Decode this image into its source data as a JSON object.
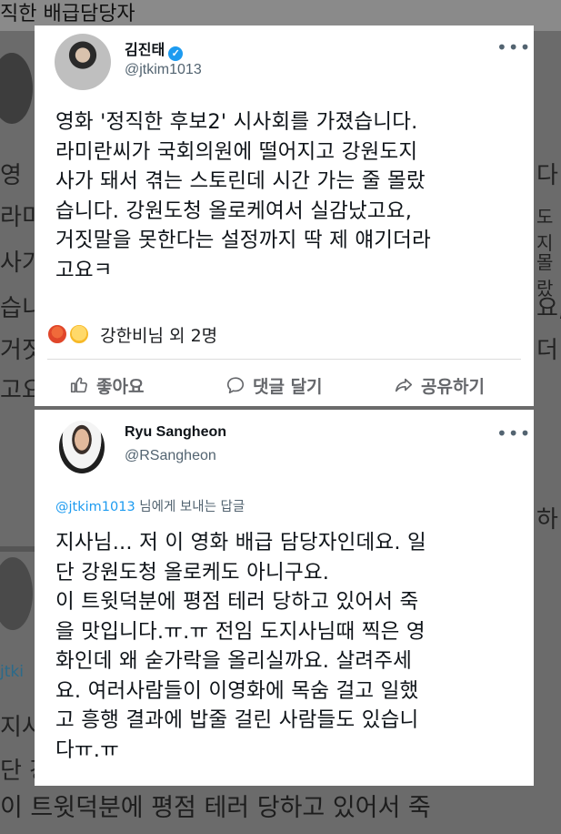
{
  "background": {
    "title": "직한 배급담당자",
    "left_fragments": [
      "영",
      "라미",
      "사가",
      "습니",
      "거짓",
      "고요"
    ],
    "right_fragments": [
      "다",
      "도지",
      "몰랐",
      "요,",
      "더"
    ],
    "reply_fragment": "jtki",
    "reply_right": "하",
    "bottom_fragments": [
      "지사",
      "단 강",
      "이 트윗덕분에 평점 테러 당하고 있어서 죽"
    ]
  },
  "tweet1": {
    "author_name": "김진태",
    "handle": "@jtkim1013",
    "more": "•••",
    "text_lines": [
      "영화 '정직한 후보2' 시사회를 가졌습니다.",
      "라미란씨가 국회의원에 떨어지고 강원도지",
      "사가 돼서 겪는 스토린데 시간 가는 줄 몰랐",
      "습니다. 강원도청 올로케여서 실감났고요,",
      "거짓말을 못한다는 설정까지 딱 제 얘기더라",
      "고요ㅋ"
    ],
    "reactions_text": "강한비님 외 2명",
    "actions": {
      "like": "좋아요",
      "comment": "댓글 달기",
      "share": "공유하기"
    }
  },
  "tweet2": {
    "author_name": "Ryu Sangheon",
    "handle": "@RSangheon",
    "more": "•••",
    "reply_mention": "@jtkim1013",
    "reply_suffix": " 님에게 보내는 답글",
    "text_lines": [
      "지사님... 저 이 영화 배급 담당자인데요. 일",
      "단 강원도청 올로케도 아니구요.",
      "이 트윗덕분에 평점 테러 당하고 있어서 죽",
      "을 맛입니다.ㅠ.ㅠ 전임 도지사님때 찍은 영",
      "화인데 왜 숟가락을 올리실까요. 살려주세",
      "요. 여러사람들이 이영화에 목숨 걸고 일했",
      "고 흥행 결과에 밥줄 걸린 사람들도 있습니",
      "다ㅠ.ㅠ"
    ]
  },
  "colors": {
    "mention_blue": "#1d9bf0",
    "verified_blue": "#1d9bf0",
    "secondary_text": "#536471",
    "action_gray": "#65676b"
  }
}
